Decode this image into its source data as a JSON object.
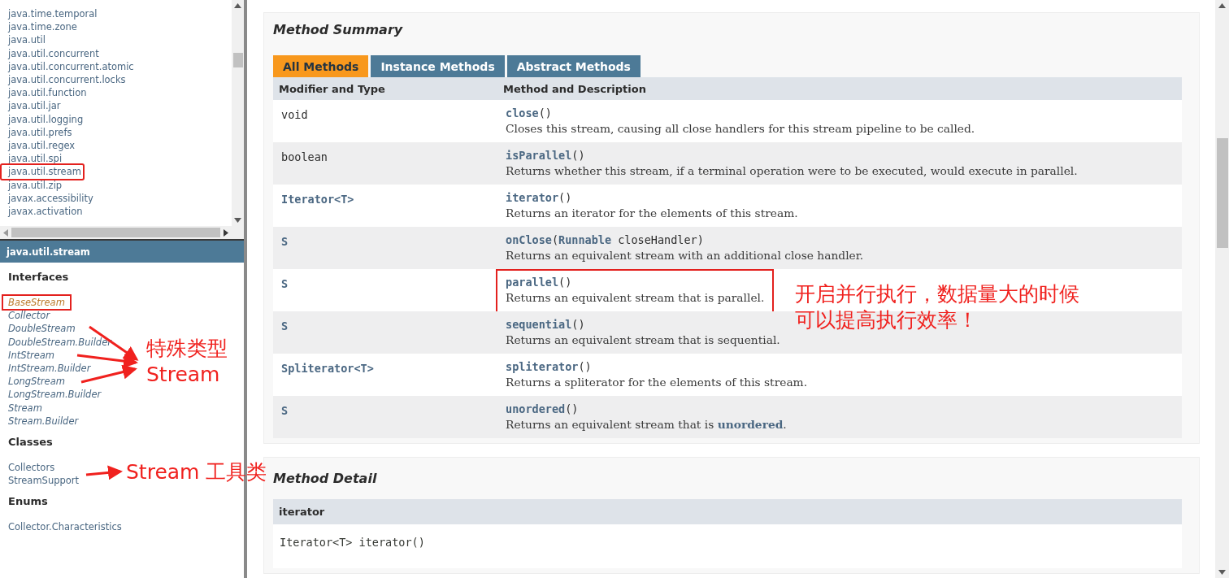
{
  "packages": [
    {
      "name": "java.time.temporal",
      "highlighted": false
    },
    {
      "name": "java.time.zone",
      "highlighted": false
    },
    {
      "name": "java.util",
      "highlighted": false
    },
    {
      "name": "java.util.concurrent",
      "highlighted": false
    },
    {
      "name": "java.util.concurrent.atomic",
      "highlighted": false
    },
    {
      "name": "java.util.concurrent.locks",
      "highlighted": false
    },
    {
      "name": "java.util.function",
      "highlighted": false
    },
    {
      "name": "java.util.jar",
      "highlighted": false
    },
    {
      "name": "java.util.logging",
      "highlighted": false
    },
    {
      "name": "java.util.prefs",
      "highlighted": false
    },
    {
      "name": "java.util.regex",
      "highlighted": false
    },
    {
      "name": "java.util.spi",
      "highlighted": false
    },
    {
      "name": "java.util.stream",
      "highlighted": true
    },
    {
      "name": "java.util.zip",
      "highlighted": false
    },
    {
      "name": "javax.accessibility",
      "highlighted": false
    },
    {
      "name": "javax.activation",
      "highlighted": false
    }
  ],
  "package_frame": {
    "title": "java.util.stream",
    "sections": [
      {
        "heading": "Interfaces",
        "italic": true,
        "items": [
          {
            "name": "BaseStream",
            "selected": true,
            "highlighted": true
          },
          {
            "name": "Collector",
            "selected": false,
            "highlighted": false
          },
          {
            "name": "DoubleStream",
            "selected": false,
            "highlighted": false
          },
          {
            "name": "DoubleStream.Builder",
            "selected": false,
            "highlighted": false
          },
          {
            "name": "IntStream",
            "selected": false,
            "highlighted": false
          },
          {
            "name": "IntStream.Builder",
            "selected": false,
            "highlighted": false
          },
          {
            "name": "LongStream",
            "selected": false,
            "highlighted": false
          },
          {
            "name": "LongStream.Builder",
            "selected": false,
            "highlighted": false
          },
          {
            "name": "Stream",
            "selected": false,
            "highlighted": false
          },
          {
            "name": "Stream.Builder",
            "selected": false,
            "highlighted": false
          }
        ]
      },
      {
        "heading": "Classes",
        "italic": false,
        "items": [
          {
            "name": "Collectors",
            "selected": false,
            "highlighted": false
          },
          {
            "name": "StreamSupport",
            "selected": false,
            "highlighted": false
          }
        ]
      },
      {
        "heading": "Enums",
        "italic": false,
        "items": [
          {
            "name": "Collector.Characteristics",
            "selected": false,
            "highlighted": false
          }
        ]
      }
    ]
  },
  "method_summary": {
    "title": "Method Summary",
    "tabs": [
      {
        "label": "All Methods",
        "selected": true
      },
      {
        "label": "Instance Methods",
        "selected": false
      },
      {
        "label": "Abstract Methods",
        "selected": false
      }
    ],
    "columns": [
      "Modifier and Type",
      "Method and Description"
    ],
    "rows": [
      {
        "modifier": "void",
        "modifier_link": false,
        "method": "**close**()",
        "description": "Closes this stream, causing all close handlers for this stream pipeline to be called.",
        "highlighted": false
      },
      {
        "modifier": "boolean",
        "modifier_link": false,
        "method": "**isParallel**()",
        "description": "Returns whether this stream, if a terminal operation were to be executed, would execute in parallel.",
        "highlighted": false
      },
      {
        "modifier": "Iterator<T>",
        "modifier_link": true,
        "method": "**iterator**()",
        "description": "Returns an iterator for the elements of this stream.",
        "highlighted": false
      },
      {
        "modifier": "S",
        "modifier_link": true,
        "method": "**onClose**(**Runnable** closeHandler)",
        "description": "Returns an equivalent stream with an additional close handler.",
        "highlighted": false
      },
      {
        "modifier": "S",
        "modifier_link": true,
        "method": "**parallel**()",
        "description": "Returns an equivalent stream that is parallel.",
        "highlighted": true
      },
      {
        "modifier": "S",
        "modifier_link": true,
        "method": "**sequential**()",
        "description": "Returns an equivalent stream that is sequential.",
        "highlighted": false
      },
      {
        "modifier": "Spliterator<T>",
        "modifier_link": true,
        "method": "**spliterator**()",
        "description": "Returns a spliterator for the elements of this stream.",
        "highlighted": false
      },
      {
        "modifier": "S",
        "modifier_link": true,
        "method": "**unordered**()",
        "description": "Returns an equivalent stream that is **unordered**.",
        "highlighted": false
      }
    ]
  },
  "method_detail": {
    "title": "Method Detail",
    "header": "iterator",
    "signature": "Iterator<T> iterator()"
  },
  "annotations": [
    {
      "kind": "interfaces",
      "lines": [
        "特殊类型",
        "Stream"
      ]
    },
    {
      "kind": "classes",
      "lines": [
        "Stream 工具类"
      ]
    },
    {
      "kind": "method",
      "lines": [
        "开启并行执行，数据量大的时候",
        "可以提高执行效率！"
      ]
    }
  ]
}
